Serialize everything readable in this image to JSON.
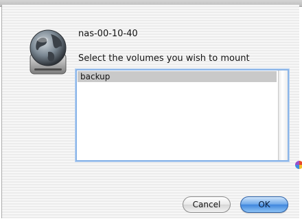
{
  "dialog": {
    "server_name": "nas-00-10-40",
    "prompt": "Select the volumes you wish to mount"
  },
  "volumes": {
    "items": [
      "backup"
    ],
    "selected": "backup"
  },
  "buttons": {
    "cancel_label": "Cancel",
    "ok_label": "OK"
  },
  "icons": {
    "server": "network-globe-drive-icon",
    "color_wheel": "color-wheel-icon"
  },
  "colors": {
    "selection": "#c9c9c9",
    "list_focus_ring": "#8bb5e8",
    "default_button": "#3f86dd"
  }
}
